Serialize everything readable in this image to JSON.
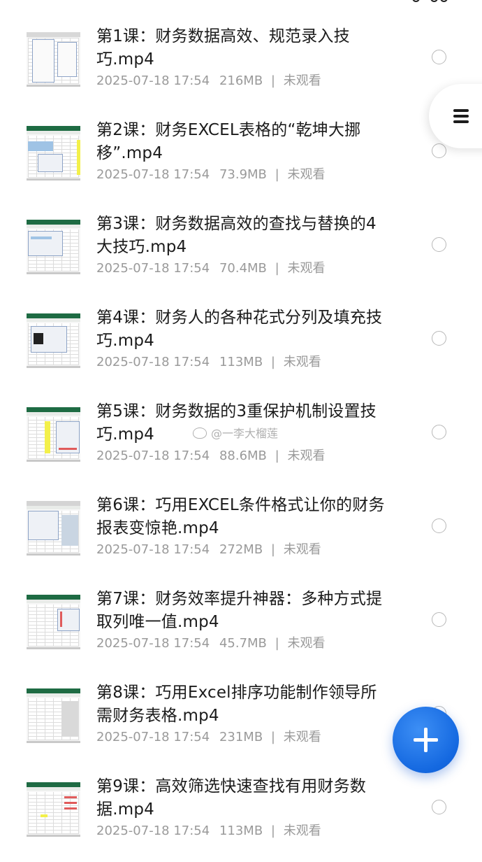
{
  "files": [
    {
      "title": "第1课：财务数据高效、规范录入技巧.mp4",
      "date": "2025-07-18 17:54",
      "size": "216MB",
      "status": "未观看"
    },
    {
      "title": "第2课：财务EXCEL表格的“乾坤大挪移”.mp4",
      "date": "2025-07-18 17:54",
      "size": "73.9MB",
      "status": "未观看"
    },
    {
      "title": "第3课：财务数据高效的查找与替换的4大技巧.mp4",
      "date": "2025-07-18 17:54",
      "size": "70.4MB",
      "status": "未观看"
    },
    {
      "title": "第4课：财务人的各种花式分列及填充技巧.mp4",
      "date": "2025-07-18 17:54",
      "size": "113MB",
      "status": "未观看"
    },
    {
      "title": "第5课：财务数据的3重保护机制设置技巧.mp4",
      "date": "2025-07-18 17:54",
      "size": "88.6MB",
      "status": "未观看"
    },
    {
      "title": "第6课：巧用EXCEL条件格式让你的财务报表变惊艳.mp4",
      "date": "2025-07-18 17:54",
      "size": "272MB",
      "status": "未观看"
    },
    {
      "title": "第7课：财务效率提升神器：多种方式提取列唯一值.mp4",
      "date": "2025-07-18 17:54",
      "size": "45.7MB",
      "status": "未观看"
    },
    {
      "title": "第8课：巧用Excel排序功能制作领导所需财务表格.mp4",
      "date": "2025-07-18 17:54",
      "size": "231MB",
      "status": "未观看"
    },
    {
      "title": "第9课：高效筛选快速查找有用财务数据.mp4",
      "date": "2025-07-18 17:54",
      "size": "113MB",
      "status": "未观看"
    }
  ],
  "separator": "|",
  "watermark": "@一李大榴莲",
  "icons": {
    "menu": "menu-icon",
    "add": "plus-icon",
    "thumbnail": "spreadsheet-video-thumbnail"
  },
  "colors": {
    "fab_blue": "#1468e0",
    "excel_green": "#1e6b43",
    "meta_gray": "#9a9a9a",
    "title_text": "#1b1b1b"
  }
}
